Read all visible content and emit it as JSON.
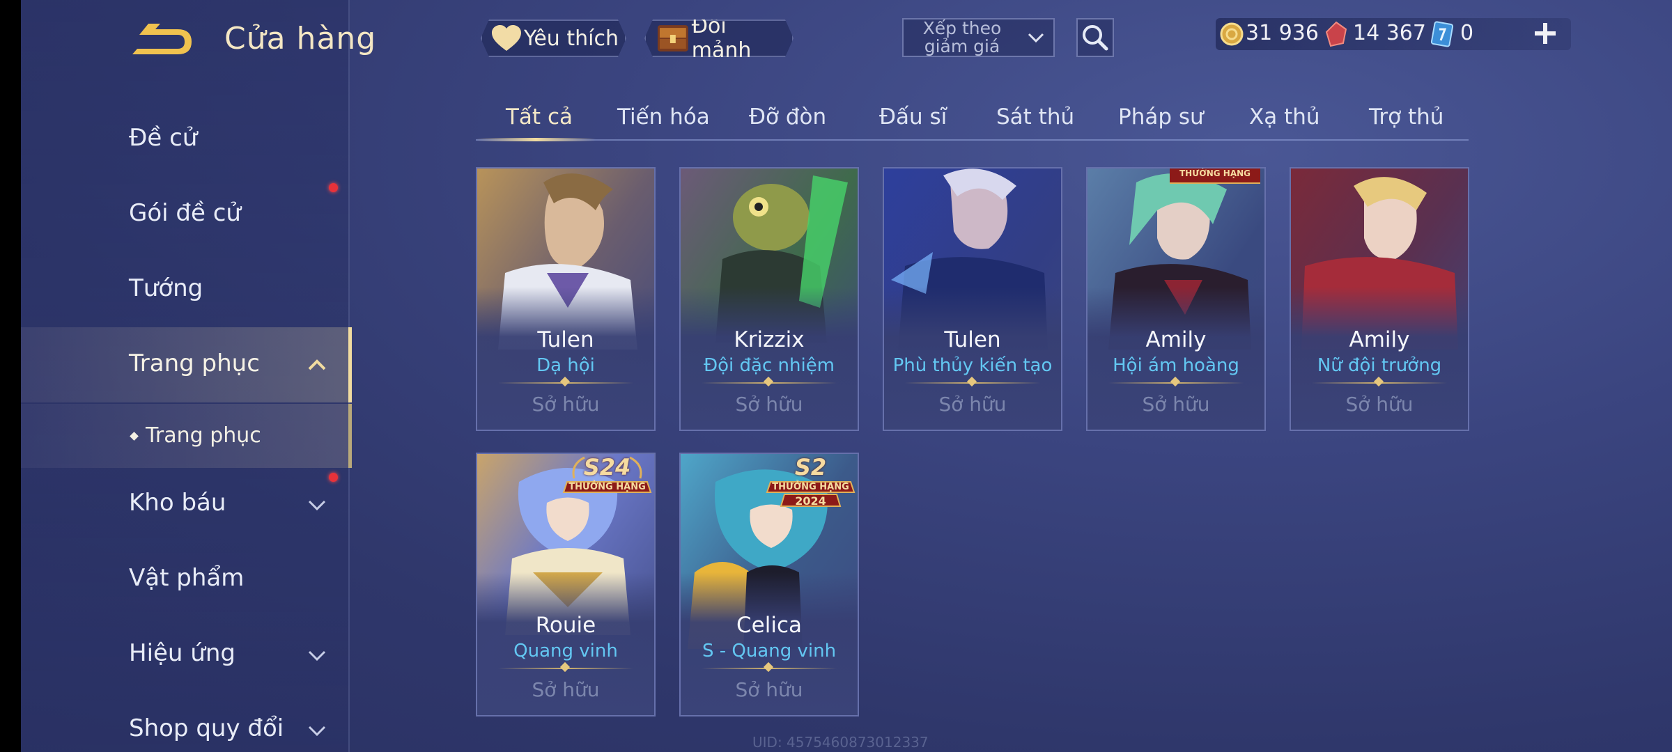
{
  "header": {
    "title": "Cửa hàng"
  },
  "sidebar": {
    "items": [
      {
        "label": "Đề cử"
      },
      {
        "label": "Gói đề cử"
      },
      {
        "label": "Tướng"
      },
      {
        "label": "Trang phục"
      },
      {
        "label": "Trang phục"
      },
      {
        "label": "Kho báu"
      },
      {
        "label": "Vật phẩm"
      },
      {
        "label": "Hiệu ứng"
      },
      {
        "label": "Shop quy đổi"
      }
    ]
  },
  "toolbar": {
    "favorite_label": "Yêu thích",
    "exchange_label": "Đổi mảnh",
    "sort_label": "Xếp theo giảm giá"
  },
  "currency": {
    "gold": "31 936",
    "gems": "14 367",
    "vouchers": "0"
  },
  "tabs": [
    {
      "label": "Tất cả"
    },
    {
      "label": "Tiến hóa"
    },
    {
      "label": "Đỡ đòn"
    },
    {
      "label": "Đấu sĩ"
    },
    {
      "label": "Sát thủ"
    },
    {
      "label": "Pháp sư"
    },
    {
      "label": "Xạ thủ"
    },
    {
      "label": "Trợ thủ"
    }
  ],
  "cards": [
    {
      "hero": "Tulen",
      "skin": "Dạ hội",
      "status": "Sở hữu"
    },
    {
      "hero": "Krizzix",
      "skin": "Đội đặc nhiệm",
      "status": "Sở hữu"
    },
    {
      "hero": "Tulen",
      "skin": "Phù thủy kiến tạo",
      "status": "Sở hữu"
    },
    {
      "hero": "Amily",
      "skin": "Hội ám hoàng",
      "status": "Sở hữu",
      "badge_text": "THƯỞNG HẠNG"
    },
    {
      "hero": "Amily",
      "skin": "Nữ đội trưởng",
      "status": "Sở hữu"
    },
    {
      "hero": "Rouie",
      "skin": "Quang vinh",
      "status": "Sở hữu",
      "badge_season": "S24",
      "badge_text": "THƯỞNG HẠNG"
    },
    {
      "hero": "Celica",
      "skin": "S - Quang vinh",
      "status": "Sở hữu",
      "badge_season": "S2",
      "badge_text": "THƯỞNG HẠNG",
      "badge_year": "2024"
    }
  ],
  "footer": {
    "uid": "UID: 4575460873012337"
  },
  "colors": {
    "accent_gold": "#f1dca0",
    "skin_name": "#63c7f2",
    "notify": "#e8323a"
  }
}
